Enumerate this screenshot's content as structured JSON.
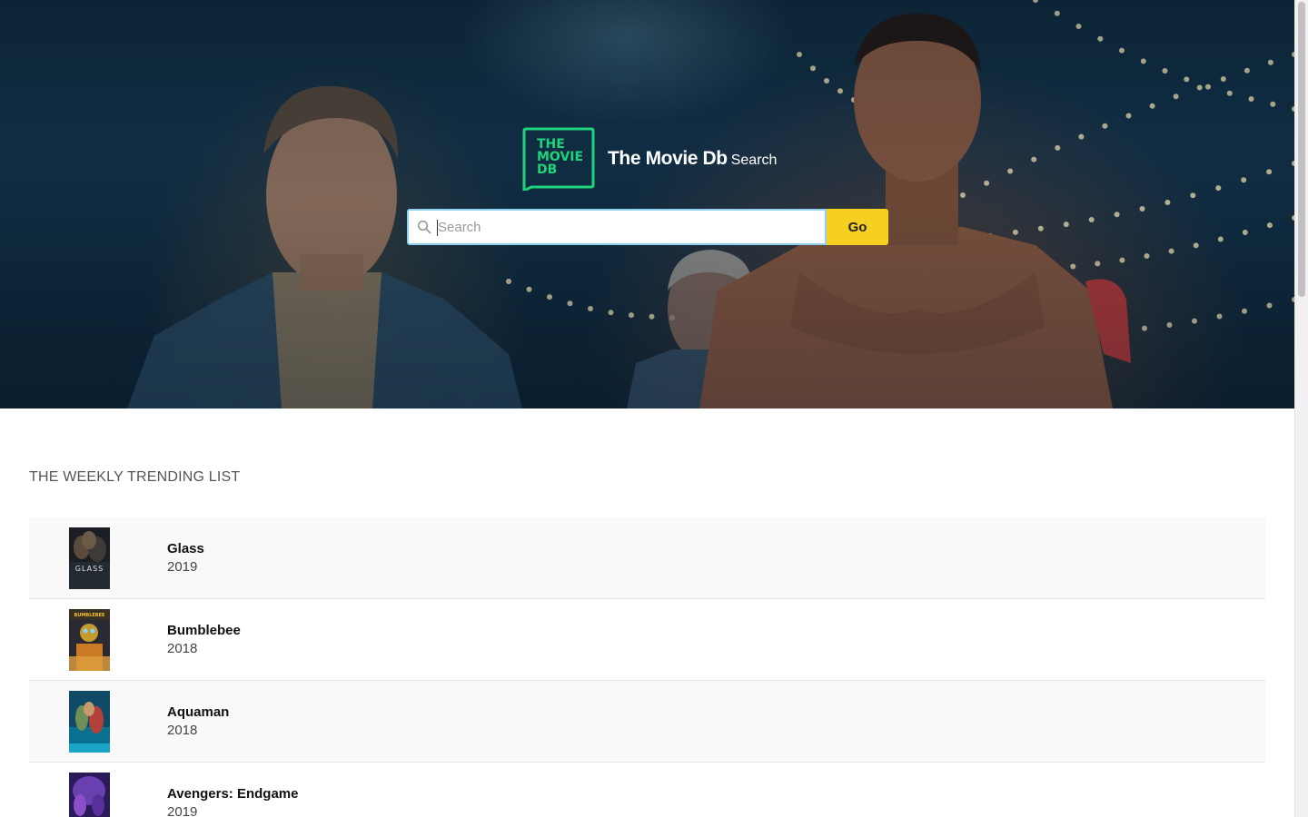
{
  "header": {
    "logo_lines": [
      "THE",
      "MOVIE",
      "DB"
    ],
    "title": "The Movie Db",
    "subtitle": "Search",
    "brand_color": "#1ed37a"
  },
  "search": {
    "placeholder": "Search",
    "value": "",
    "button_label": "Go",
    "button_color": "#f5d020",
    "focus_color": "#8fd0ef"
  },
  "trending": {
    "title": "THE WEEKLY TRENDING LIST",
    "items": [
      {
        "title": "Glass",
        "year": "2019",
        "poster_text": "GLASS"
      },
      {
        "title": "Bumblebee",
        "year": "2018",
        "poster_text": "BUMBLEBEE"
      },
      {
        "title": "Aquaman",
        "year": "2018",
        "poster_text": ""
      },
      {
        "title": "Avengers: Endgame",
        "year": "2019",
        "poster_text": ""
      }
    ]
  },
  "icons": {
    "search": "search-icon",
    "logo": "tmdb-logo-icon"
  }
}
